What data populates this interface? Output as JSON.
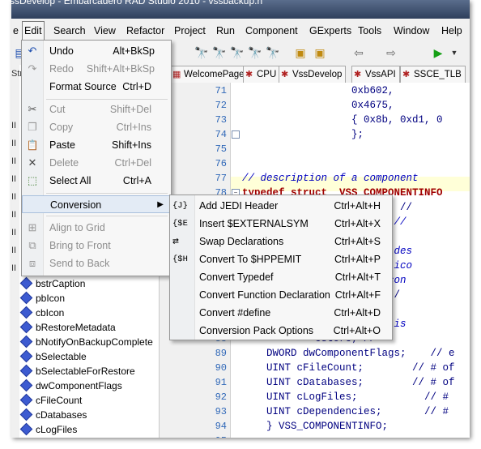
{
  "titlebar": {
    "text": "ssDevelop - Embarcadero RAD Studio 2010 - vssbackup.h"
  },
  "menubar": {
    "items": [
      "e",
      "Edit",
      "Search",
      "View",
      "Refactor",
      "Project",
      "Run",
      "Component",
      "GExperts",
      "Tools",
      "Window",
      "Help"
    ]
  },
  "tabs": [
    {
      "label": "WelcomePage",
      "icon": "page-icon"
    },
    {
      "label": "CPU",
      "icon": "cpu-icon"
    },
    {
      "label": "VssDevelop",
      "icon": "project-icon"
    },
    {
      "label": "VssAPI",
      "icon": "unit-icon"
    },
    {
      "label": "SSCE_TLB",
      "icon": "unit-icon"
    }
  ],
  "left_tree": {
    "items": [
      "bstrCaption",
      "pbIcon",
      "cbIcon",
      "bRestoreMetadata",
      "bNotifyOnBackupComplete",
      "bSelectable",
      "bSelectableForRestore",
      "dwComponentFlags",
      "cFileCount",
      "cDatabases",
      "cLogFiles"
    ],
    "side_labels": [
      "Str",
      "II",
      "II",
      "II",
      "II",
      "II",
      "II",
      "II",
      "II",
      "II"
    ]
  },
  "editor": {
    "line_numbers": [
      "71",
      "72",
      "73",
      "74",
      "75",
      "76",
      "77",
      "78",
      "79",
      "80",
      "81",
      "82",
      "83",
      "84",
      "85",
      "86",
      "87",
      "88",
      "89",
      "90",
      "91",
      "92",
      "93",
      "94",
      "95",
      "96"
    ],
    "lines": [
      "                  0xb602,",
      "                  0x4675,",
      "                  { 0x8b, 0xd1, 0",
      "                  };",
      "",
      "",
      "// description of a component",
      "typedef struct _VSS_COMPONENTINFO",
      "                  ype;    //",
      "                         //",
      "                  me;",
      "                      // des",
      "                      // ico",
      "                    // icon",
      "                 a;      /",
      "            Complete;",
      "                      // is",
      "            estore; //",
      "    DWORD dwComponentFlags;    // e",
      "    UINT cFileCount;        // # of",
      "    UINT cDatabases;        // # of",
      "    UINT cLogFiles;           // #",
      "    UINT cDependencies;       // #",
      "    } VSS_COMPONENTINFO;",
      "",
      ""
    ]
  },
  "edit_menu": {
    "items": [
      {
        "label": "Undo",
        "shortcut": "Alt+BkSp",
        "icon": "undo-icon",
        "glyph": "↶",
        "disabled": false
      },
      {
        "label": "Redo",
        "shortcut": "Shift+Alt+BkSp",
        "icon": "redo-icon",
        "glyph": "↷",
        "disabled": true
      },
      {
        "label": "Format Source",
        "shortcut": "Ctrl+D",
        "icon": "",
        "glyph": "",
        "disabled": false
      },
      {
        "label": "Cut",
        "shortcut": "Shift+Del",
        "icon": "scissors-icon",
        "glyph": "✂",
        "disabled": true
      },
      {
        "label": "Copy",
        "shortcut": "Ctrl+Ins",
        "icon": "copy-icon",
        "glyph": "❐",
        "disabled": true
      },
      {
        "label": "Paste",
        "shortcut": "Shift+Ins",
        "icon": "paste-icon",
        "glyph": "📋",
        "disabled": false
      },
      {
        "label": "Delete",
        "shortcut": "Ctrl+Del",
        "icon": "delete-icon",
        "glyph": "✕",
        "disabled": true
      },
      {
        "label": "Select All",
        "shortcut": "Ctrl+A",
        "icon": "select-all-icon",
        "glyph": "⬚",
        "disabled": false
      },
      {
        "label": "Conversion",
        "shortcut": "",
        "icon": "",
        "glyph": "",
        "disabled": false
      },
      {
        "label": "Align to Grid",
        "shortcut": "",
        "icon": "align-grid-icon",
        "glyph": "⊞",
        "disabled": true
      },
      {
        "label": "Bring to Front",
        "shortcut": "",
        "icon": "bring-front-icon",
        "glyph": "⧉",
        "disabled": true
      },
      {
        "label": "Send to Back",
        "shortcut": "",
        "icon": "send-back-icon",
        "glyph": "⧈",
        "disabled": true
      }
    ]
  },
  "conversion_menu": {
    "items": [
      {
        "label": "Add JEDI Header",
        "shortcut": "Ctrl+Alt+H",
        "tag": "{J}"
      },
      {
        "label": "Insert $EXTERNALSYM",
        "shortcut": "Ctrl+Alt+X",
        "tag": "{$E"
      },
      {
        "label": "Swap Declarations",
        "shortcut": "Ctrl+Alt+S",
        "tag": "⇄"
      },
      {
        "label": "Convert To $HPPEMIT",
        "shortcut": "Ctrl+Alt+P",
        "tag": "{$H"
      },
      {
        "label": "Convert Typedef",
        "shortcut": "Ctrl+Alt+T",
        "tag": ""
      },
      {
        "label": "Convert Function Declaration",
        "shortcut": "Ctrl+Alt+F",
        "tag": ""
      },
      {
        "label": "Convert #define",
        "shortcut": "Ctrl+Alt+D",
        "tag": ""
      },
      {
        "label": "Conversion Pack Options",
        "shortcut": "Ctrl+Alt+O",
        "tag": ""
      }
    ]
  }
}
